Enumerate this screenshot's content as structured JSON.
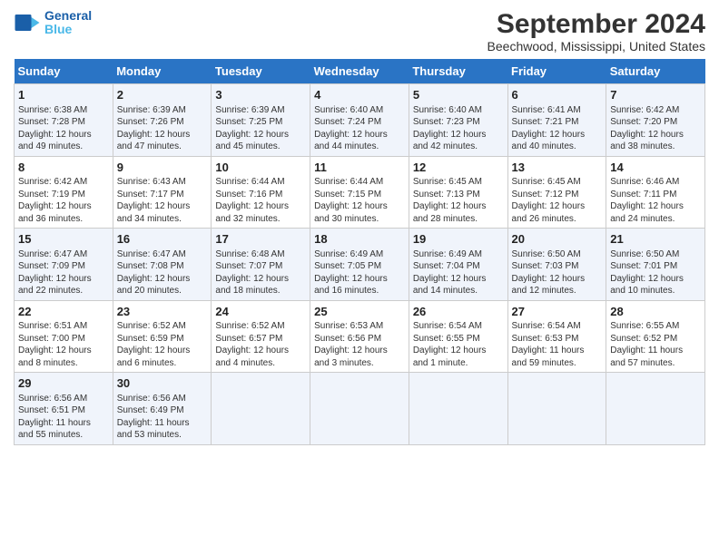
{
  "header": {
    "logo_line1": "General",
    "logo_line2": "Blue",
    "title": "September 2024",
    "subtitle": "Beechwood, Mississippi, United States"
  },
  "days_of_week": [
    "Sunday",
    "Monday",
    "Tuesday",
    "Wednesday",
    "Thursday",
    "Friday",
    "Saturday"
  ],
  "weeks": [
    [
      {
        "day": "1",
        "detail": "Sunrise: 6:38 AM\nSunset: 7:28 PM\nDaylight: 12 hours\nand 49 minutes."
      },
      {
        "day": "2",
        "detail": "Sunrise: 6:39 AM\nSunset: 7:26 PM\nDaylight: 12 hours\nand 47 minutes."
      },
      {
        "day": "3",
        "detail": "Sunrise: 6:39 AM\nSunset: 7:25 PM\nDaylight: 12 hours\nand 45 minutes."
      },
      {
        "day": "4",
        "detail": "Sunrise: 6:40 AM\nSunset: 7:24 PM\nDaylight: 12 hours\nand 44 minutes."
      },
      {
        "day": "5",
        "detail": "Sunrise: 6:40 AM\nSunset: 7:23 PM\nDaylight: 12 hours\nand 42 minutes."
      },
      {
        "day": "6",
        "detail": "Sunrise: 6:41 AM\nSunset: 7:21 PM\nDaylight: 12 hours\nand 40 minutes."
      },
      {
        "day": "7",
        "detail": "Sunrise: 6:42 AM\nSunset: 7:20 PM\nDaylight: 12 hours\nand 38 minutes."
      }
    ],
    [
      {
        "day": "8",
        "detail": "Sunrise: 6:42 AM\nSunset: 7:19 PM\nDaylight: 12 hours\nand 36 minutes."
      },
      {
        "day": "9",
        "detail": "Sunrise: 6:43 AM\nSunset: 7:17 PM\nDaylight: 12 hours\nand 34 minutes."
      },
      {
        "day": "10",
        "detail": "Sunrise: 6:44 AM\nSunset: 7:16 PM\nDaylight: 12 hours\nand 32 minutes."
      },
      {
        "day": "11",
        "detail": "Sunrise: 6:44 AM\nSunset: 7:15 PM\nDaylight: 12 hours\nand 30 minutes."
      },
      {
        "day": "12",
        "detail": "Sunrise: 6:45 AM\nSunset: 7:13 PM\nDaylight: 12 hours\nand 28 minutes."
      },
      {
        "day": "13",
        "detail": "Sunrise: 6:45 AM\nSunset: 7:12 PM\nDaylight: 12 hours\nand 26 minutes."
      },
      {
        "day": "14",
        "detail": "Sunrise: 6:46 AM\nSunset: 7:11 PM\nDaylight: 12 hours\nand 24 minutes."
      }
    ],
    [
      {
        "day": "15",
        "detail": "Sunrise: 6:47 AM\nSunset: 7:09 PM\nDaylight: 12 hours\nand 22 minutes."
      },
      {
        "day": "16",
        "detail": "Sunrise: 6:47 AM\nSunset: 7:08 PM\nDaylight: 12 hours\nand 20 minutes."
      },
      {
        "day": "17",
        "detail": "Sunrise: 6:48 AM\nSunset: 7:07 PM\nDaylight: 12 hours\nand 18 minutes."
      },
      {
        "day": "18",
        "detail": "Sunrise: 6:49 AM\nSunset: 7:05 PM\nDaylight: 12 hours\nand 16 minutes."
      },
      {
        "day": "19",
        "detail": "Sunrise: 6:49 AM\nSunset: 7:04 PM\nDaylight: 12 hours\nand 14 minutes."
      },
      {
        "day": "20",
        "detail": "Sunrise: 6:50 AM\nSunset: 7:03 PM\nDaylight: 12 hours\nand 12 minutes."
      },
      {
        "day": "21",
        "detail": "Sunrise: 6:50 AM\nSunset: 7:01 PM\nDaylight: 12 hours\nand 10 minutes."
      }
    ],
    [
      {
        "day": "22",
        "detail": "Sunrise: 6:51 AM\nSunset: 7:00 PM\nDaylight: 12 hours\nand 8 minutes."
      },
      {
        "day": "23",
        "detail": "Sunrise: 6:52 AM\nSunset: 6:59 PM\nDaylight: 12 hours\nand 6 minutes."
      },
      {
        "day": "24",
        "detail": "Sunrise: 6:52 AM\nSunset: 6:57 PM\nDaylight: 12 hours\nand 4 minutes."
      },
      {
        "day": "25",
        "detail": "Sunrise: 6:53 AM\nSunset: 6:56 PM\nDaylight: 12 hours\nand 3 minutes."
      },
      {
        "day": "26",
        "detail": "Sunrise: 6:54 AM\nSunset: 6:55 PM\nDaylight: 12 hours\nand 1 minute."
      },
      {
        "day": "27",
        "detail": "Sunrise: 6:54 AM\nSunset: 6:53 PM\nDaylight: 11 hours\nand 59 minutes."
      },
      {
        "day": "28",
        "detail": "Sunrise: 6:55 AM\nSunset: 6:52 PM\nDaylight: 11 hours\nand 57 minutes."
      }
    ],
    [
      {
        "day": "29",
        "detail": "Sunrise: 6:56 AM\nSunset: 6:51 PM\nDaylight: 11 hours\nand 55 minutes."
      },
      {
        "day": "30",
        "detail": "Sunrise: 6:56 AM\nSunset: 6:49 PM\nDaylight: 11 hours\nand 53 minutes."
      },
      {
        "day": "",
        "detail": ""
      },
      {
        "day": "",
        "detail": ""
      },
      {
        "day": "",
        "detail": ""
      },
      {
        "day": "",
        "detail": ""
      },
      {
        "day": "",
        "detail": ""
      }
    ]
  ]
}
